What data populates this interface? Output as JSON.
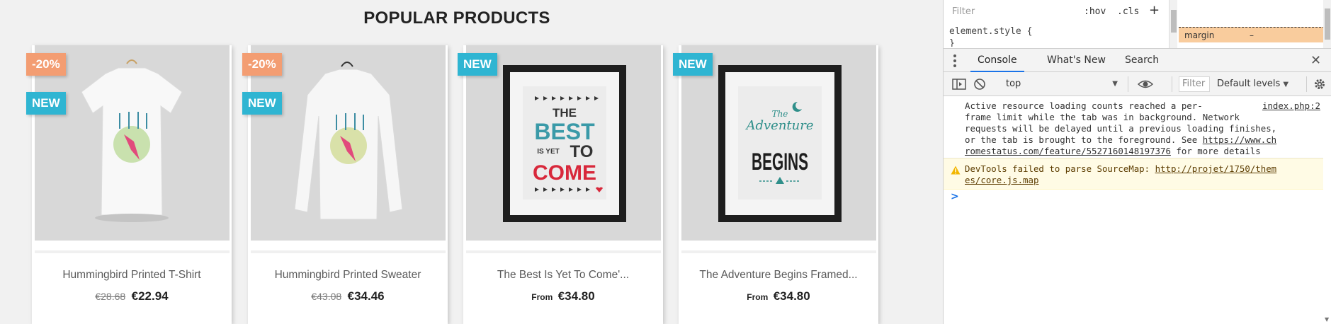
{
  "shop": {
    "section_title": "POPULAR PRODUCTS",
    "products": [
      {
        "name": "Hummingbird Printed T-Shirt",
        "regular_price": "€28.68",
        "price": "€22.94",
        "price_prefix": "",
        "flags": [
          "-20%",
          "NEW"
        ],
        "image": "tshirt-hummingbird-image"
      },
      {
        "name": "Hummingbird Printed Sweater",
        "regular_price": "€43.08",
        "price": "€34.46",
        "price_prefix": "",
        "flags": [
          "-20%",
          "NEW"
        ],
        "image": "sweater-hummingbird-image"
      },
      {
        "name": "The Best Is Yet To Come'...",
        "regular_price": "",
        "price": "€34.80",
        "price_prefix": "From",
        "flags": [
          "NEW"
        ],
        "image": "poster-best-is-yet-to-come-image",
        "poster_text": [
          "THE",
          "BEST",
          "IS YET",
          "TO",
          "COME"
        ]
      },
      {
        "name": "The Adventure Begins Framed...",
        "regular_price": "",
        "price": "€34.80",
        "price_prefix": "From",
        "flags": [
          "NEW"
        ],
        "image": "poster-adventure-begins-image",
        "poster_text": [
          "The",
          "Adventure",
          "BEGINS"
        ]
      }
    ],
    "colors": {
      "discount_flag": "#f39d72",
      "new_flag": "#2fb5d2",
      "background": "#f1f1f1"
    }
  },
  "devtools": {
    "styles": {
      "filter_placeholder": "Filter",
      "hov": ":hov",
      "cls": ".cls",
      "add": "+",
      "element_style": "element.style {",
      "closing_brace": "}",
      "margin_label": "margin",
      "margin_value": "–"
    },
    "tabs": [
      {
        "label": "Console",
        "active": true
      },
      {
        "label": "What's New",
        "active": false
      },
      {
        "label": "Search",
        "active": false
      }
    ],
    "close": "✕",
    "toolbar": {
      "context": "top",
      "filter_placeholder": "Filter",
      "levels": "Default levels"
    },
    "messages": {
      "info": {
        "text": "Active resource loading counts reached a per-frame limit while the tab was in background. Network requests will be delayed until a previous loading finishes, or the tab is brought to the foreground. See ",
        "link": "https://www.chromestatus.com/feature/5527160148197376",
        "suffix": " for more details",
        "source": "index.php:2",
        "lines": [
          "Active resource loading counts reached a per-",
          "frame limit while the tab was in background. Network",
          "requests will be delayed until a previous loading finishes,",
          "or the tab is brought to the foreground. See "
        ],
        "link_part1": "https://www.ch",
        "link_part2": "romestatus.com/feature/5527160148197376"
      },
      "warning": {
        "text": "DevTools failed to parse SourceMap: ",
        "link_part1": "http://projet/1750/them",
        "link_part2": "es/core.js.map"
      }
    },
    "prompt": ">"
  }
}
